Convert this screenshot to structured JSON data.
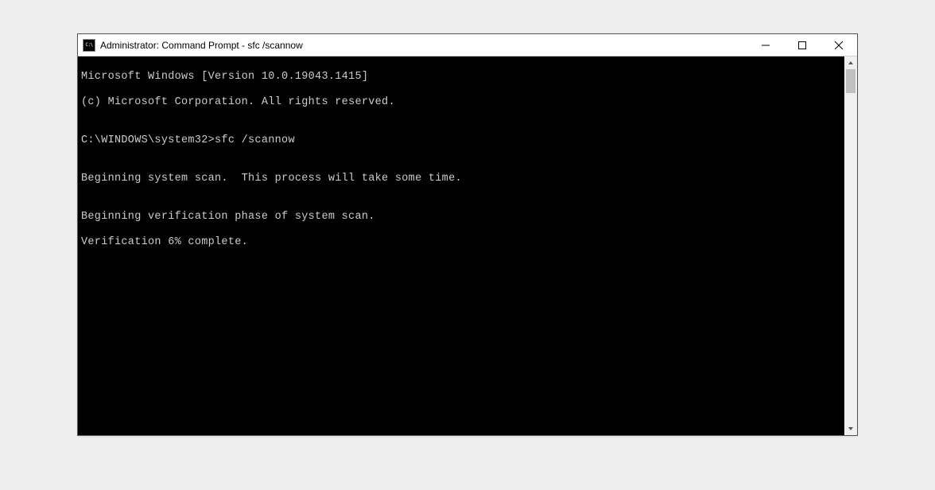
{
  "titlebar": {
    "title": "Administrator: Command Prompt - sfc  /scannow",
    "icon_label": "C:\\"
  },
  "terminal": {
    "lines": [
      "Microsoft Windows [Version 10.0.19043.1415]",
      "(c) Microsoft Corporation. All rights reserved.",
      "",
      "C:\\WINDOWS\\system32>sfc /scannow",
      "",
      "Beginning system scan.  This process will take some time.",
      "",
      "Beginning verification phase of system scan.",
      "Verification 6% complete."
    ]
  },
  "colors": {
    "terminal_bg": "#000000",
    "terminal_fg": "#cccccc",
    "window_bg": "#ffffff",
    "page_bg": "#eeeeee"
  }
}
